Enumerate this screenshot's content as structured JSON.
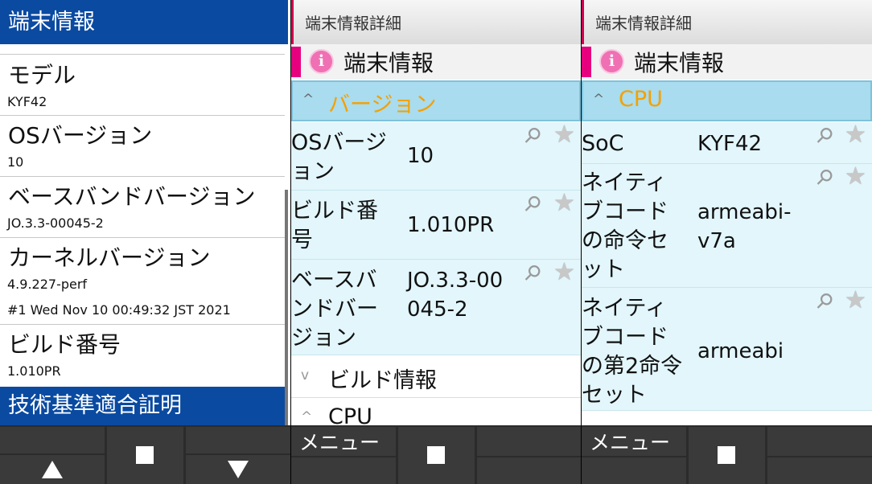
{
  "panel1": {
    "header": "端末情報",
    "items": [
      {
        "title": "モデル",
        "sub": "KYF42"
      },
      {
        "title": "OSバージョン",
        "sub": "10"
      },
      {
        "title": "ベースバンドバージョン",
        "sub": "JO.3.3-00045-2"
      },
      {
        "title": "カーネルバージョン",
        "sub": "4.9.227-perf",
        "sub2": "#1 Wed Nov 10 00:49:32 JST 2021"
      },
      {
        "title": "ビルド番号",
        "sub": "1.010PR"
      }
    ],
    "selected": "技術基準適合証明"
  },
  "panel2": {
    "header": "端末情報詳細",
    "subheader": "端末情報",
    "section_open": "バージョン",
    "rows": [
      {
        "label": "OSバージョン",
        "value": "10"
      },
      {
        "label": "ビルド番号",
        "value": "1.010PR"
      },
      {
        "label": "ベースバンドバージョン",
        "value": "JO.3.3-00045-2"
      }
    ],
    "collapsed1": "ビルド情報",
    "collapsed2": "CPU"
  },
  "panel3": {
    "header": "端末情報詳細",
    "subheader": "端末情報",
    "section_open": "CPU",
    "rows": [
      {
        "label": "SoC",
        "value": "KYF42"
      },
      {
        "label": "ネイティブコードの命令セット",
        "value": "armeabi-v7a"
      },
      {
        "label": "ネイティブコードの第2命令セット",
        "value": "armeabi"
      }
    ]
  },
  "bottom": {
    "menu_label": "メニュー"
  },
  "icons": {
    "info": "i",
    "chevron_up": "^",
    "chevron_down": "v",
    "clip": "paperclip-icon",
    "star": "star-icon"
  },
  "colors": {
    "header_blue": "#0a4aa1",
    "accent_pink": "#e6007e",
    "section_orange": "#f5a000",
    "row_bg": "#e2f6fb"
  }
}
